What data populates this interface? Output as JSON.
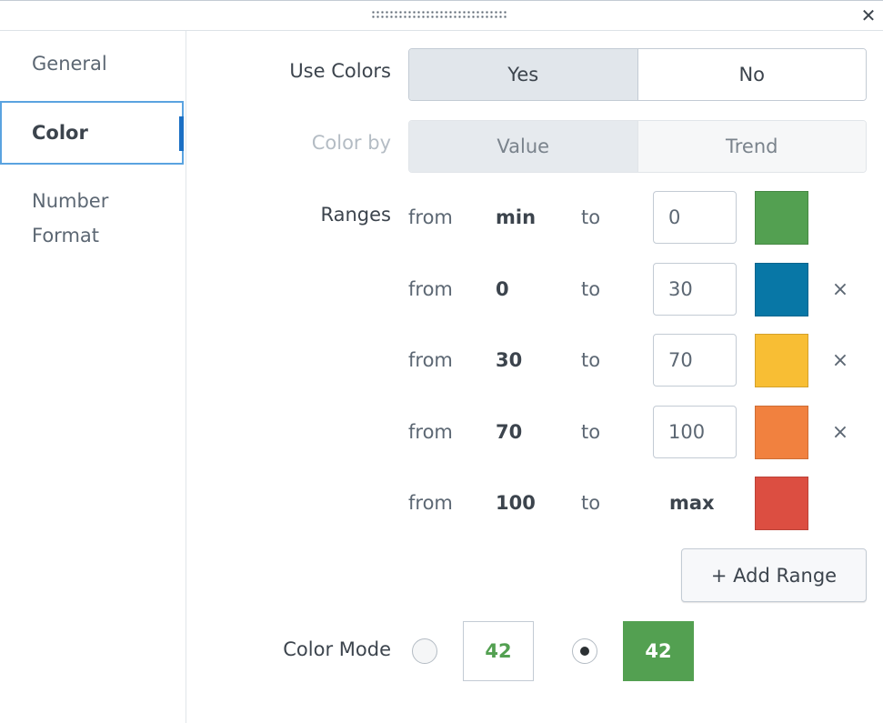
{
  "window": {
    "close_icon": "close-icon",
    "drag_handle": "drag-handle-icon"
  },
  "sidebar": {
    "items": [
      {
        "label": "General",
        "active": false
      },
      {
        "label": "Color",
        "active": true
      },
      {
        "label": "Number Format",
        "active": false
      }
    ]
  },
  "use_colors": {
    "label": "Use Colors",
    "options": [
      "Yes",
      "No"
    ],
    "selected": "Yes"
  },
  "color_by": {
    "label": "Color by",
    "options": [
      "Value",
      "Trend"
    ],
    "selected": "Value",
    "disabled": true
  },
  "ranges": {
    "label": "Ranges",
    "from_word": "from",
    "to_word": "to",
    "rows": [
      {
        "from": "min",
        "to": "0",
        "color": "#53a051",
        "removable": false
      },
      {
        "from": "0",
        "to": "30",
        "color": "#0877a6",
        "removable": true
      },
      {
        "from": "30",
        "to": "70",
        "color": "#f8be34",
        "removable": true
      },
      {
        "from": "70",
        "to": "100",
        "color": "#f1813f",
        "removable": true
      },
      {
        "from": "100",
        "to": "max",
        "color": "#dc4e41",
        "removable": false
      }
    ],
    "remove_symbol": "×",
    "add_button": "+ Add Range"
  },
  "color_mode": {
    "label": "Color Mode",
    "options": [
      {
        "value": "42",
        "style": "text",
        "checked": false,
        "text_color": "#53a051",
        "bg": "#ffffff"
      },
      {
        "value": "42",
        "style": "block",
        "checked": true,
        "text_color": "#ffffff",
        "bg": "#53a051"
      }
    ]
  }
}
